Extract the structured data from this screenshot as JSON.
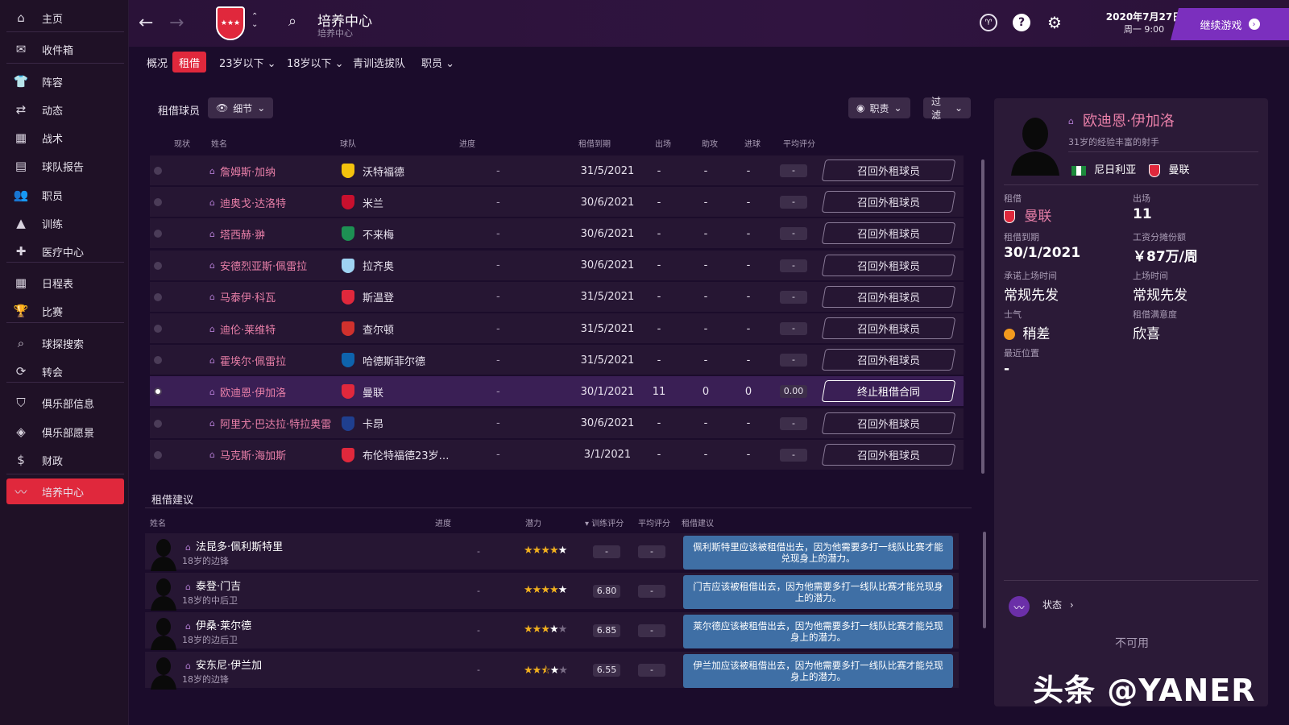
{
  "sidebar": {
    "items": [
      {
        "label": "主页",
        "icon": "home-icon",
        "glyph": "⌂"
      },
      {
        "label": "收件箱",
        "icon": "inbox-icon",
        "glyph": "✉"
      },
      {
        "label": "阵容",
        "icon": "shirt-icon",
        "glyph": "👕"
      },
      {
        "label": "动态",
        "icon": "dynamics-icon",
        "glyph": "⇄"
      },
      {
        "label": "战术",
        "icon": "tactics-icon",
        "glyph": "▦"
      },
      {
        "label": "球队报告",
        "icon": "report-icon",
        "glyph": "▤"
      },
      {
        "label": "职员",
        "icon": "staff-icon",
        "glyph": "👥"
      },
      {
        "label": "训练",
        "icon": "training-icon",
        "glyph": "▲"
      },
      {
        "label": "医疗中心",
        "icon": "medical-icon",
        "glyph": "✚"
      },
      {
        "label": "日程表",
        "icon": "calendar-icon",
        "glyph": "▦"
      },
      {
        "label": "比赛",
        "icon": "trophy-icon",
        "glyph": "🏆"
      },
      {
        "label": "球探搜索",
        "icon": "search-icon",
        "glyph": "⌕"
      },
      {
        "label": "转会",
        "icon": "transfer-icon",
        "glyph": "⟳"
      },
      {
        "label": "俱乐部信息",
        "icon": "shield-icon",
        "glyph": "⛉"
      },
      {
        "label": "俱乐部愿景",
        "icon": "vision-icon",
        "glyph": "◈"
      },
      {
        "label": "财政",
        "icon": "money-icon",
        "glyph": "$"
      },
      {
        "label": "培养中心",
        "icon": "development-icon",
        "glyph": "〰"
      }
    ]
  },
  "header": {
    "title": "培养中心",
    "subtitle": "培养中心",
    "date": "2020年7月27日",
    "day_time": "周一 9:00",
    "continue_label": "继续游戏",
    "help_glyph": "?"
  },
  "tabs": [
    {
      "label": "概况"
    },
    {
      "label": "租借",
      "active": true
    },
    {
      "label": "23岁以下 ⌄"
    },
    {
      "label": "18岁以下 ⌄"
    },
    {
      "label": "青训选拔队"
    },
    {
      "label": "职员 ⌄"
    }
  ],
  "loans": {
    "section_title": "租借球员",
    "detail_label": "细节",
    "role_label": "职责",
    "filter_label": "过滤",
    "columns": {
      "status": "现状",
      "name": "姓名",
      "club": "球队",
      "progress": "进度",
      "expiry": "租借到期",
      "apps": "出场",
      "assists": "助攻",
      "goals": "进球",
      "avg": "平均评分"
    },
    "rows": [
      {
        "name": "詹姆斯·加纳",
        "club": "沃特福德",
        "club_color": "#f4c20d",
        "progress": "-",
        "expiry": "31/5/2021",
        "apps": "-",
        "assists": "-",
        "goals": "-",
        "avg": "-",
        "action": "召回外租球员"
      },
      {
        "name": "迪奥戈·达洛特",
        "club": "米兰",
        "club_color": "#c8102e",
        "progress": "-",
        "expiry": "30/6/2021",
        "apps": "-",
        "assists": "-",
        "goals": "-",
        "avg": "-",
        "action": "召回外租球员"
      },
      {
        "name": "塔西赫·翀",
        "club": "不来梅",
        "club_color": "#1d9053",
        "progress": "-",
        "expiry": "30/6/2021",
        "apps": "-",
        "assists": "-",
        "goals": "-",
        "avg": "-",
        "action": "召回外租球员"
      },
      {
        "name": "安德烈亚斯·佩雷拉",
        "club": "拉齐奥",
        "club_color": "#9fd3f2",
        "progress": "-",
        "expiry": "30/6/2021",
        "apps": "-",
        "assists": "-",
        "goals": "-",
        "avg": "-",
        "action": "召回外租球员"
      },
      {
        "name": "马泰伊·科瓦",
        "club": "斯温登",
        "club_color": "#e0283c",
        "progress": "-",
        "expiry": "31/5/2021",
        "apps": "-",
        "assists": "-",
        "goals": "-",
        "avg": "-",
        "action": "召回外租球员"
      },
      {
        "name": "迪伦·莱维特",
        "club": "查尔顿",
        "club_color": "#d0312d",
        "progress": "-",
        "expiry": "31/5/2021",
        "apps": "-",
        "assists": "-",
        "goals": "-",
        "avg": "-",
        "action": "召回外租球员"
      },
      {
        "name": "霍埃尔·佩雷拉",
        "club": "哈德斯菲尔德",
        "club_color": "#0e63ad",
        "progress": "-",
        "expiry": "31/5/2021",
        "apps": "-",
        "assists": "-",
        "goals": "-",
        "avg": "-",
        "action": "召回外租球员"
      },
      {
        "name": "欧迪恩·伊加洛",
        "club": "曼联",
        "club_color": "#e0283c",
        "progress": "-",
        "expiry": "30/1/2021",
        "apps": "11",
        "assists": "0",
        "goals": "0",
        "avg": "0.00",
        "action": "终止租借合同",
        "selected": true
      },
      {
        "name": "阿里尤·巴达拉·特拉奥雷",
        "club": "卡昂",
        "club_color": "#1f3f8f",
        "progress": "-",
        "expiry": "30/6/2021",
        "apps": "-",
        "assists": "-",
        "goals": "-",
        "avg": "-",
        "action": "召回外租球员"
      },
      {
        "name": "马克斯·海加斯",
        "club": "布伦特福德23岁…",
        "club_color": "#e0283c",
        "progress": "-",
        "expiry": "3/1/2021",
        "apps": "-",
        "assists": "-",
        "goals": "-",
        "avg": "-",
        "action": "召回外租球员"
      }
    ]
  },
  "suggestions": {
    "section_title": "租借建议",
    "columns": {
      "name": "姓名",
      "progress": "进度",
      "potential": "潜力",
      "training": "训练评分",
      "avg": "平均评分",
      "advice": "租借建议"
    },
    "rows": [
      {
        "name": "法昆多·佩利斯特里",
        "desc": "18岁的边锋",
        "progress": "-",
        "stars_full": 4,
        "stars_half": 0,
        "stars_white": 1,
        "training": "-",
        "avg": "-",
        "advice": "佩利斯特里应该被租借出去，因为他需要多打一线队比赛才能兑现身上的潜力。"
      },
      {
        "name": "泰登·门吉",
        "desc": "18岁的中后卫",
        "progress": "-",
        "stars_full": 4,
        "stars_half": 0,
        "stars_white": 1,
        "training": "6.80",
        "avg": "-",
        "advice": "门吉应该被租借出去，因为他需要多打一线队比赛才能兑现身上的潜力。"
      },
      {
        "name": "伊桑·莱尔德",
        "desc": "18岁的边后卫",
        "progress": "-",
        "stars_full": 3,
        "stars_half": 0,
        "stars_white": 1,
        "training": "6.85",
        "avg": "-",
        "advice": "莱尔德应该被租借出去，因为他需要多打一线队比赛才能兑现身上的潜力。"
      },
      {
        "name": "安东尼·伊兰加",
        "desc": "18岁的边锋",
        "progress": "-",
        "stars_full": 2,
        "stars_half": 1,
        "stars_white": 1,
        "training": "6.55",
        "avg": "-",
        "advice": "伊兰加应该被租借出去，因为他需要多打一线队比赛才能兑现身上的潜力。"
      }
    ]
  },
  "player_panel": {
    "name": "欧迪恩·伊加洛",
    "desc": "31岁的经验丰富的射手",
    "nation": "尼日利亚",
    "club": "曼联",
    "loan_label": "租借",
    "loan_club": "曼联",
    "apps_label": "出场",
    "apps_value": "11",
    "expiry_label": "租借到期",
    "expiry_value": "30/1/2021",
    "wage_label": "工资分摊份额",
    "wage_value": "￥87万/周",
    "promised_label": "承诺上场时间",
    "promised_value": "常规先发",
    "playing_label": "上场时间",
    "playing_value": "常规先发",
    "morale_label": "士气",
    "morale_value": "稍差",
    "satisfaction_label": "租借满意度",
    "satisfaction_value": "欣喜",
    "position_label": "最近位置",
    "position_value": "-",
    "status_link": "状态",
    "unavailable": "不可用"
  },
  "watermark": "头条 @YANER"
}
